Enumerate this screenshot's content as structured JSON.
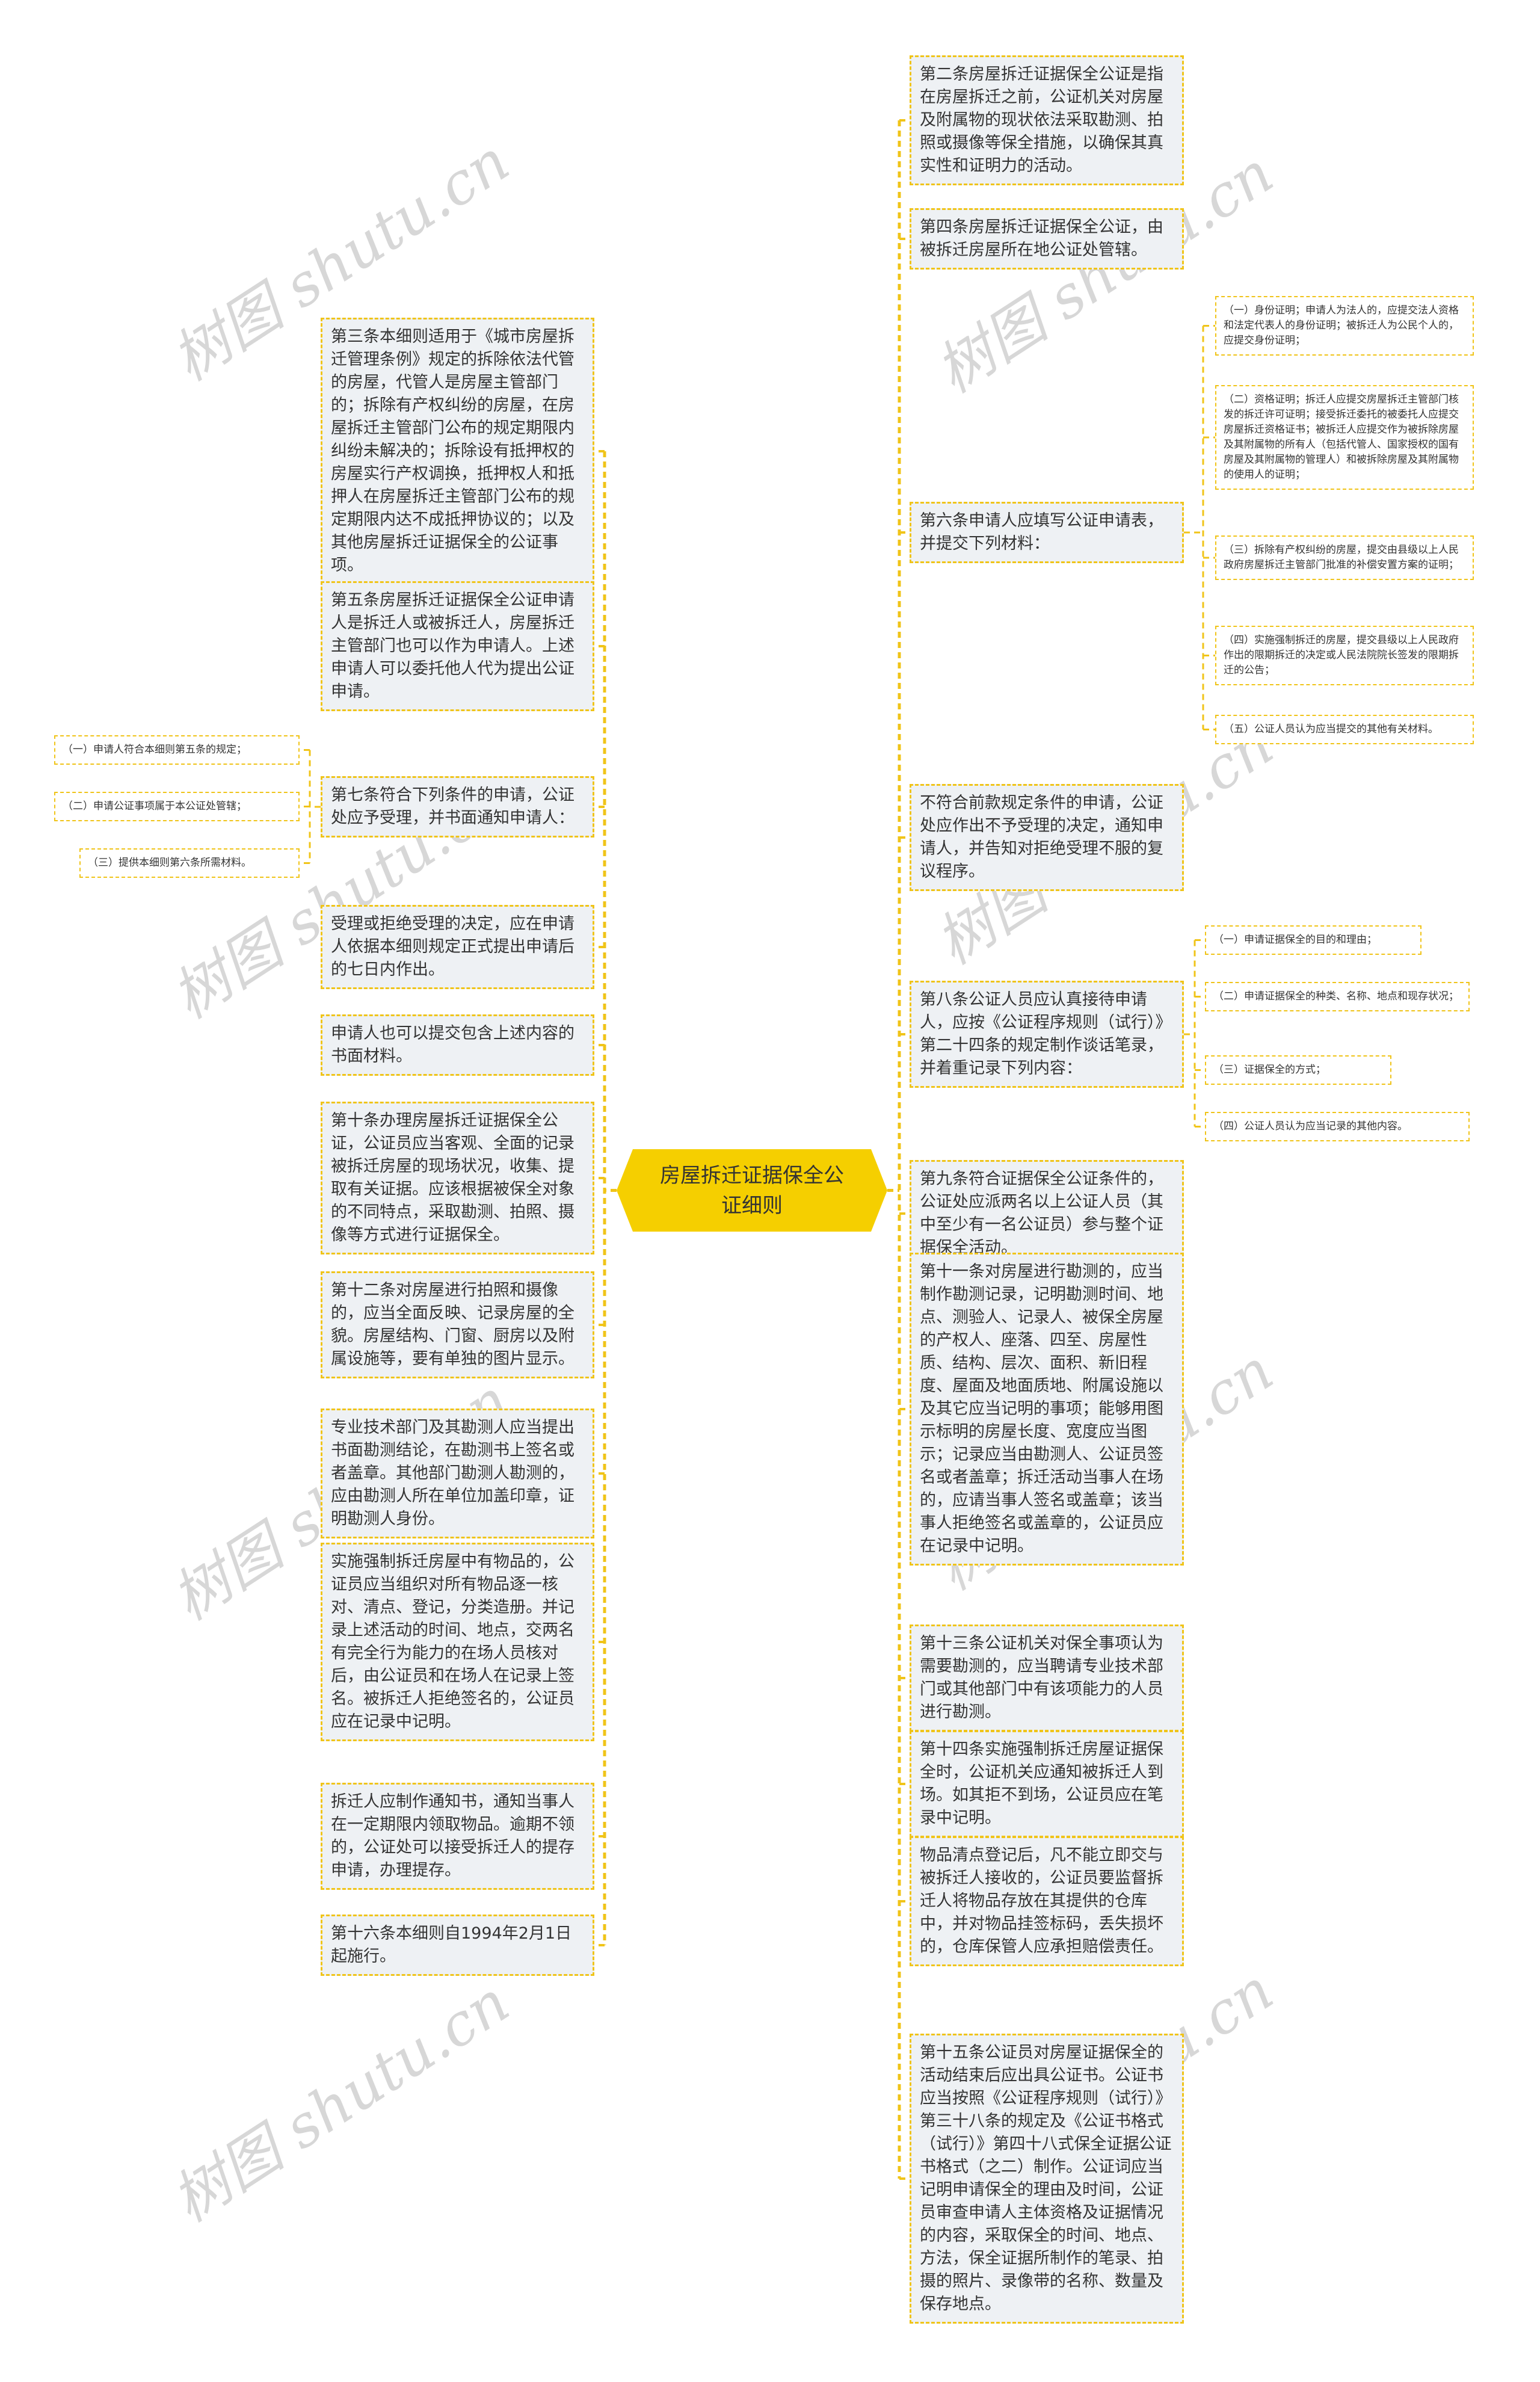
{
  "title": "房屋拆迁证据保全公证细则",
  "watermark_text": "树图 shutu.cn",
  "colors": {
    "accent": "#f5cf00",
    "connector": "#f0c419",
    "node_bg": "#eef1f4",
    "text": "#333333"
  },
  "right_branches": [
    {
      "text": "第二条房屋拆迁证据保全公证是指在房屋拆迁之前，公证机关对房屋及附属物的现状依法采取勘测、拍照或摄像等保全措施，以确保其真实性和证明力的活动。"
    },
    {
      "text": "第四条房屋拆迁证据保全公证，由被拆迁房屋所在地公证处管辖。"
    },
    {
      "text": "第六条申请人应填写公证申请表，并提交下列材料：",
      "children": [
        "（一）身份证明；申请人为法人的，应提交法人资格和法定代表人的身份证明；被拆迁人为公民个人的，应提交身份证明；",
        "（二）资格证明；拆迁人应提交房屋拆迁主管部门核发的拆迁许可证明；接受拆迁委托的被委托人应提交房屋拆迁资格证书；被拆迁人应提交作为被拆除房屋及其附属物的所有人（包括代管人、国家授权的国有房屋及其附属物的管理人）和被拆除房屋及其附属物的使用人的证明；",
        "（三）拆除有产权纠纷的房屋，提交由县级以上人民政府房屋拆迁主管部门批准的补偿安置方案的证明；",
        "（四）实施强制拆迁的房屋，提交县级以上人民政府作出的限期拆迁的决定或人民法院院长签发的限期拆迁的公告；",
        "（五）公证人员认为应当提交的其他有关材料。"
      ]
    },
    {
      "text": "不符合前款规定条件的申请，公证处应作出不予受理的决定，通知申请人，并告知对拒绝受理不服的复议程序。"
    },
    {
      "text": "第八条公证人员应认真接待申请人，应按《公证程序规则（试行）》第二十四条的规定制作谈话笔录，并着重记录下列内容：",
      "children": [
        "（一）申请证据保全的目的和理由；",
        "（二）申请证据保全的种类、名称、地点和现存状况；",
        "（三）证据保全的方式；",
        "（四）公证人员认为应当记录的其他内容。"
      ]
    },
    {
      "text": "第九条符合证据保全公证条件的，公证处应派两名以上公证人员（其中至少有一名公证员）参与整个证据保全活动。"
    },
    {
      "text": "第十一条对房屋进行勘测的，应当制作勘测记录，记明勘测时间、地点、测验人、记录人、被保全房屋的产权人、座落、四至、房屋性质、结构、层次、面积、新旧程度、屋面及地面质地、附属设施以及其它应当记明的事项；能够用图示标明的房屋长度、宽度应当图示；记录应当由勘测人、公证员签名或者盖章；拆迁活动当事人在场的，应请当事人签名或盖章；该当事人拒绝签名或盖章的，公证员应在记录中记明。"
    },
    {
      "text": "第十三条公证机关对保全事项认为需要勘测的，应当聘请专业技术部门或其他部门中有该项能力的人员进行勘测。"
    },
    {
      "text": "第十四条实施强制拆迁房屋证据保全时，公证机关应通知被拆迁人到场。如其拒不到场，公证员应在笔录中记明。"
    },
    {
      "text": "物品清点登记后，凡不能立即交与被拆迁人接收的，公证员要监督拆迁人将物品存放在其提供的仓库中，并对物品挂签标码，丢失损坏的，仓库保管人应承担赔偿责任。"
    },
    {
      "text": "第十五条公证员对房屋证据保全的活动结束后应出具公证书。公证书应当按照《公证程序规则（试行）》第三十八条的规定及《公证书格式（试行）》第四十八式保全证据公证书格式（之二）制作。公证词应当记明申请保全的理由及时间，公证员审查申请人主体资格及证据情况的内容，采取保全的时间、地点、方法，保全证据所制作的笔录、拍摄的照片、录像带的名称、数量及保存地点。"
    }
  ],
  "left_branches": [
    {
      "text": "第三条本细则适用于《城市房屋拆迁管理条例》规定的拆除依法代管的房屋，代管人是房屋主管部门的；拆除有产权纠纷的房屋，在房屋拆迁主管部门公布的规定期限内纠纷未解决的；拆除设有抵押权的房屋实行产权调换，抵押权人和抵押人在房屋拆迁主管部门公布的规定期限内达不成抵押协议的；以及其他房屋拆迁证据保全的公证事项。"
    },
    {
      "text": "第五条房屋拆迁证据保全公证申请人是拆迁人或被拆迁人，房屋拆迁主管部门也可以作为申请人。上述申请人可以委托他人代为提出公证申请。"
    },
    {
      "text": "第七条符合下列条件的申请，公证处应予受理，并书面通知申请人：",
      "children": [
        "（一）申请人符合本细则第五条的规定；",
        "（二）申请公证事项属于本公证处管辖；",
        "（三）提供本细则第六条所需材料。"
      ]
    },
    {
      "text": "受理或拒绝受理的决定，应在申请人依据本细则规定正式提出申请后的七日内作出。"
    },
    {
      "text": "申请人也可以提交包含上述内容的书面材料。"
    },
    {
      "text": "第十条办理房屋拆迁证据保全公证，公证员应当客观、全面的记录被拆迁房屋的现场状况，收集、提取有关证据。应该根据被保全对象的不同特点，采取勘测、拍照、摄像等方式进行证据保全。"
    },
    {
      "text": "第十二条对房屋进行拍照和摄像的，应当全面反映、记录房屋的全貌。房屋结构、门窗、厨房以及附属设施等，要有单独的图片显示。"
    },
    {
      "text": "专业技术部门及其勘测人应当提出书面勘测结论，在勘测书上签名或者盖章。其他部门勘测人勘测的，应由勘测人所在单位加盖印章，证明勘测人身份。"
    },
    {
      "text": "实施强制拆迁房屋中有物品的，公证员应当组织对所有物品逐一核对、清点、登记，分类造册。并记录上述活动的时间、地点，交两名有完全行为能力的在场人员核对后，由公证员和在场人在记录上签名。被拆迁人拒绝签名的，公证员应在记录中记明。"
    },
    {
      "text": "拆迁人应制作通知书，通知当事人在一定期限内领取物品。逾期不领的，公证处可以接受拆迁人的提存申请，办理提存。"
    },
    {
      "text": "第十六条本细则自1994年2月1日起施行。"
    }
  ]
}
